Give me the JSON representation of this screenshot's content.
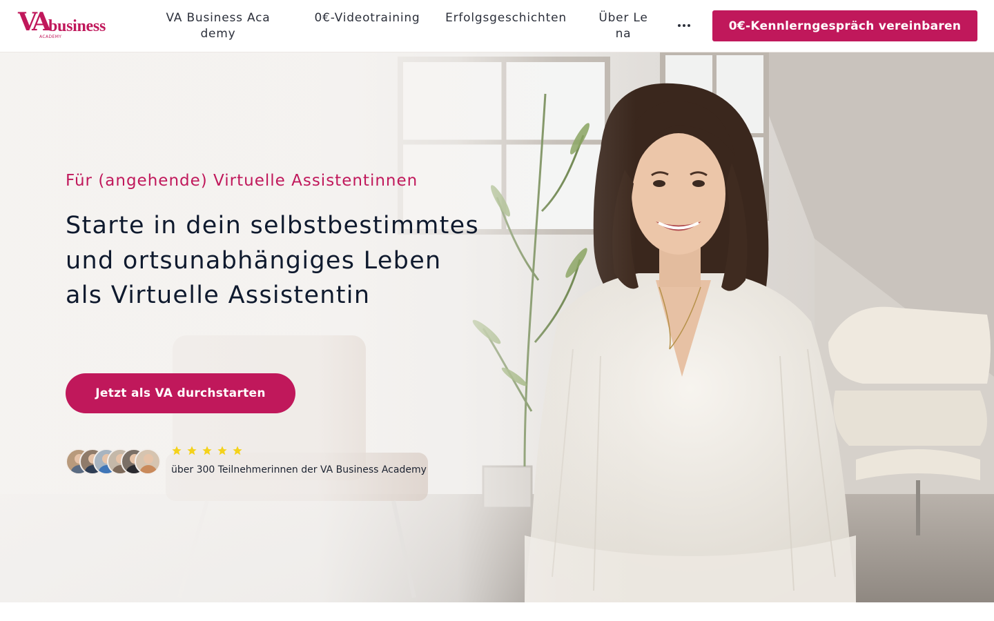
{
  "header": {
    "logo": {
      "mark": "VA",
      "wordmark": "business",
      "sub": "ACADEMY"
    },
    "nav": [
      {
        "label": "VA Business Academy"
      },
      {
        "label": "0€-Videotraining"
      },
      {
        "label": "Erfolgsgeschichten"
      },
      {
        "label": "Über Lena"
      }
    ],
    "more_icon": "ellipsis-icon",
    "cta_label": "0€-Kennlerngespräch vereinbaren"
  },
  "hero": {
    "eyebrow": "Für (angehende) Virtuelle Assistentinnen",
    "headline": "Starte in dein selbstbestimmtes und ortsunabhängiges Leben als Virtuelle Assistentin",
    "cta_label": "Jetzt als VA durchstarten",
    "social_proof": {
      "rating_stars": 5,
      "text": "über 300 Teilnehmerinnen der VA Business Academy"
    },
    "photo": "woman-portrait-photo"
  },
  "colors": {
    "brand": "#c0185b",
    "text_dark": "#0f1a2e",
    "star": "#f4d21b",
    "background": "#ffffff"
  }
}
